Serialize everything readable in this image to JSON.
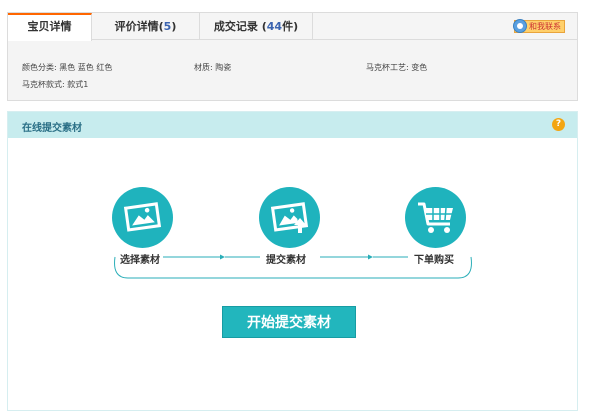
{
  "tabs": [
    {
      "label": "宝贝详情",
      "count": ""
    },
    {
      "label": "评价详情",
      "count": "5"
    },
    {
      "label": "成交记录",
      "count": "44",
      "suffix": "件"
    }
  ],
  "contact": {
    "label": "和我联系"
  },
  "attributes": {
    "color": "颜色分类: 黑色 蓝色 红色",
    "material": "材质: 陶瓷",
    "craft": "马克杯工艺: 变色",
    "style": "马克杯款式: 款式1"
  },
  "upload": {
    "title": "在线提交素材",
    "help": "?",
    "steps": [
      {
        "label": "选择素材",
        "icon": "picture-icon"
      },
      {
        "label": "提交素材",
        "icon": "upload-picture-icon"
      },
      {
        "label": "下单购买",
        "icon": "shopping-cart-icon"
      }
    ],
    "start_button": "开始提交素材"
  },
  "colors": {
    "accent": "#1fb3bd",
    "header": "#c7ecee",
    "tab_active": "#ff6600"
  }
}
